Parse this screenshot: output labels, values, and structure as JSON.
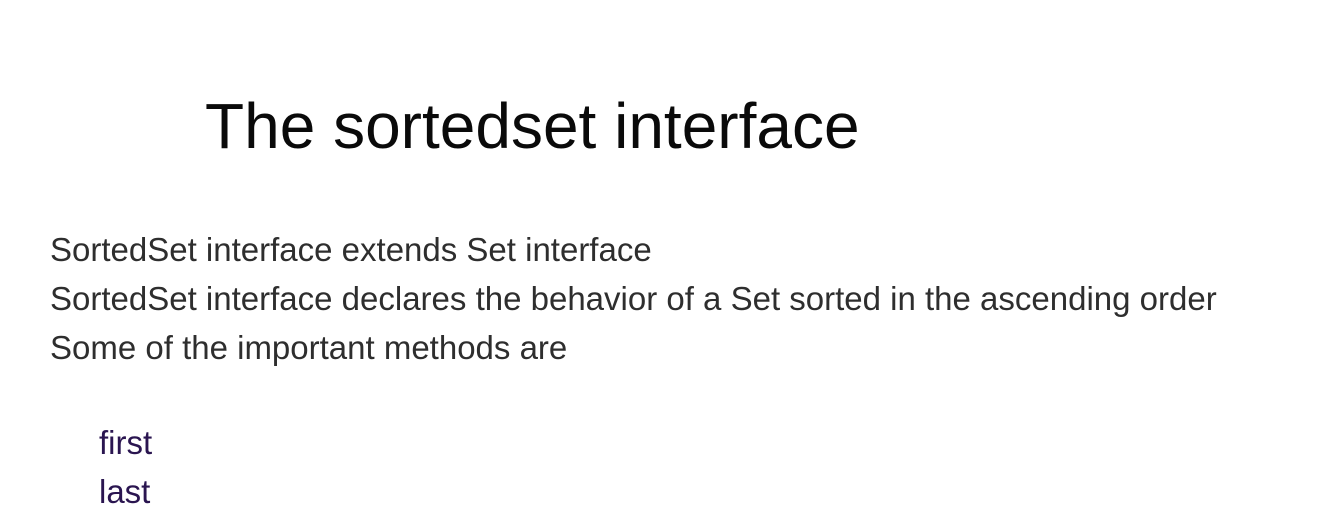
{
  "slide": {
    "title": "The sortedset interface",
    "body_lines": [
      "SortedSet interface extends Set interface",
      "SortedSet interface declares the behavior of a Set sorted in the ascending order",
      "Some of the important methods are"
    ],
    "methods": [
      "first",
      "last"
    ],
    "colors": {
      "title": "#0a0a0a",
      "body": "#2e2e2e",
      "methods": "#2a1550",
      "background": "#ffffff"
    }
  }
}
